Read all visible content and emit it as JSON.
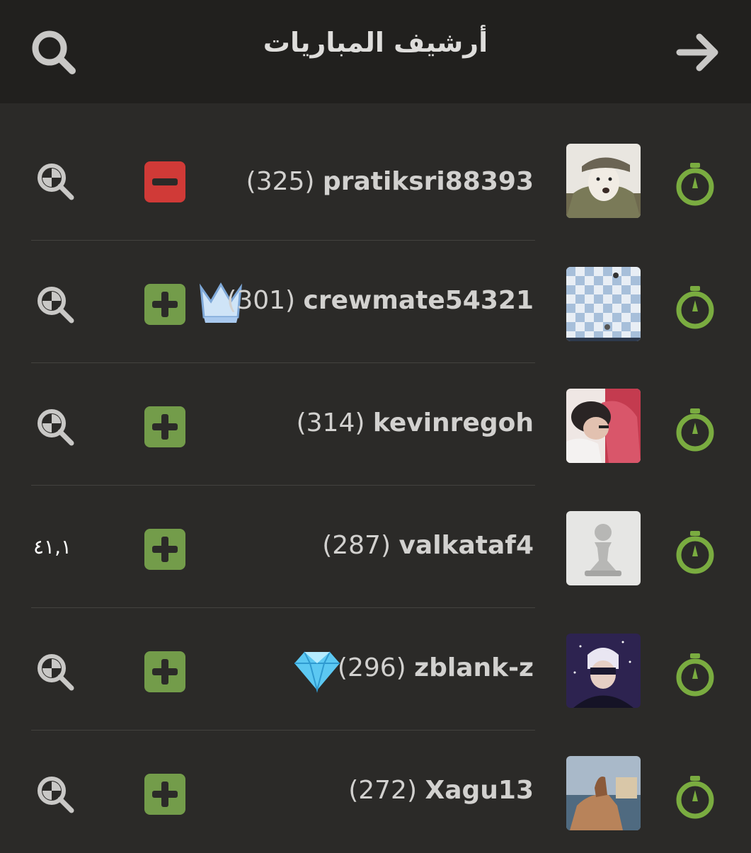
{
  "header": {
    "title": "أرشيف المباريات",
    "search_icon": "search-icon",
    "back_icon": "arrow-right-icon"
  },
  "colors": {
    "win": "#739c4a",
    "loss": "#d03a37",
    "timer": "#7aac40",
    "header_bg": "#21201e",
    "list_bg": "#2b2a28"
  },
  "games": [
    {
      "opponent": "pratiksri88393",
      "rating": "(325)",
      "result": "loss",
      "badge": null,
      "analysis": "search-plus-icon",
      "accuracy": null,
      "time_control_icon": "stopwatch-icon",
      "avatar": "dog-in-cap"
    },
    {
      "opponent": "crewmate54321",
      "rating": "(301)",
      "result": "win",
      "badge": "crown",
      "analysis": "search-plus-icon",
      "accuracy": null,
      "time_control_icon": "stopwatch-icon",
      "avatar": "chessboard"
    },
    {
      "opponent": "kevinregoh",
      "rating": "(314)",
      "result": "win",
      "badge": null,
      "analysis": "search-plus-icon",
      "accuracy": null,
      "time_control_icon": "stopwatch-icon",
      "avatar": "person-photo"
    },
    {
      "opponent": "valkataf4",
      "rating": "(287)",
      "result": "win",
      "badge": null,
      "analysis": null,
      "accuracy": "٤١,١",
      "time_control_icon": "stopwatch-icon",
      "avatar": "default-pawn"
    },
    {
      "opponent": "zblank-z",
      "rating": "(296)",
      "result": "win",
      "badge": "diamond",
      "analysis": "search-plus-icon",
      "accuracy": null,
      "time_control_icon": "stopwatch-icon",
      "avatar": "anime-character"
    },
    {
      "opponent": "Xagu13",
      "rating": "(272)",
      "result": "win",
      "badge": null,
      "analysis": "search-plus-icon",
      "accuracy": null,
      "time_control_icon": "stopwatch-icon",
      "avatar": "rock-landscape"
    }
  ]
}
